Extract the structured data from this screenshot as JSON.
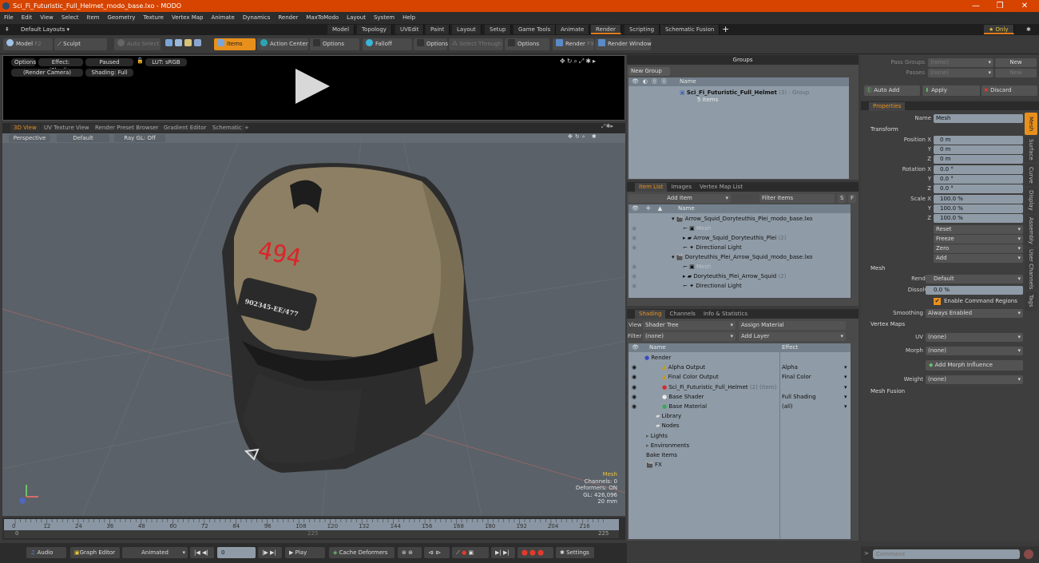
{
  "window": {
    "title": "Sci_Fi_Futuristic_Full_Helmet_modo_base.lxo - MODO",
    "minimize": "—",
    "restore": "❐",
    "close": "✕"
  },
  "menu": [
    "File",
    "Edit",
    "View",
    "Select",
    "Item",
    "Geometry",
    "Texture",
    "Vertex Map",
    "Animate",
    "Dynamics",
    "Render",
    "MaxToModo",
    "Layout",
    "System",
    "Help"
  ],
  "layouts": {
    "label": "Default Layouts ▾",
    "tabs": [
      "Model",
      "Topology",
      "UVEdit",
      "Paint",
      "Layout",
      "Setup",
      "Game Tools",
      "Animate",
      "Render",
      "Scripting",
      "Schematic Fusion"
    ],
    "active": "Render",
    "add": "+",
    "only": "★ Only"
  },
  "toolbar": {
    "model": "Model",
    "model_key": "F2",
    "sculpt": "Sculpt",
    "auto_select": "Auto Select",
    "items": "Items",
    "action_center": "Action Center",
    "options1": "Options",
    "falloff": "Falloff",
    "options2": "Options",
    "select_through": "Select Through",
    "options3": "Options",
    "render": "Render",
    "render_key": "F9",
    "render_window": "Render Window"
  },
  "render_preview": {
    "options": "Options",
    "effect": "Effect: (Shadi...",
    "paused": "Paused",
    "lut": "LUT: sRGB",
    "camera": "(Render Camera)",
    "shading": "Shading: Full"
  },
  "view_tabs": {
    "tabs": [
      "3D View",
      "UV Texture View",
      "Render Preset Browser",
      "Gradient Editor",
      "Schematic"
    ],
    "active": "3D View",
    "add": "+"
  },
  "viewport": {
    "projection": "Perspective",
    "style": "Default",
    "raygl": "Ray GL: Off",
    "decal_number": "494",
    "decal_serial": "902345-EE/477",
    "stats": {
      "title": "Mesh",
      "channels": "Channels: 0",
      "deformers": "Deformers: ON",
      "gl": "GL: 426,096",
      "scale": "20 mm"
    }
  },
  "timeline": {
    "ticks": [
      "0",
      "12",
      "24",
      "36",
      "48",
      "60",
      "72",
      "84",
      "96",
      "108",
      "120",
      "132",
      "144",
      "156",
      "168",
      "180",
      "192",
      "204",
      "216"
    ],
    "start": "0",
    "end": "225",
    "current_marker": "225"
  },
  "transport": {
    "audio": "Audio",
    "graph_editor": "Graph Editor",
    "animated": "Animated",
    "frame": "0",
    "play": "Play",
    "cache_deformers": "Cache Deformers",
    "settings": "Settings"
  },
  "groups": {
    "title": "Groups",
    "new_group": "New Group",
    "col_name": "Name",
    "item_name": "Sci_Fi_Futuristic_Full_Helmet",
    "item_suffix": "(3) : Group",
    "item_sub": "5 Items"
  },
  "itemlist": {
    "tabs": [
      "Item List",
      "Images",
      "Vertex Map List"
    ],
    "active": "Item List",
    "add_item": "Add Item",
    "filter": "Filter Items",
    "s": "S",
    "f": "F",
    "col_name": "Name",
    "rows": [
      {
        "name": "Arrow_Squid_Doryteuthis_Plei_modo_base.lxo",
        "indent": 0,
        "type": "scene"
      },
      {
        "name": "Mesh",
        "indent": 1,
        "type": "mesh",
        "dim": true
      },
      {
        "name": "Arrow_Squid_Doryteuthis_Plei",
        "suffix": "(2)",
        "indent": 1,
        "type": "group"
      },
      {
        "name": "Directional Light",
        "indent": 1,
        "type": "light"
      },
      {
        "name": "Doryteuthis_Plei_Arrow_Squid_modo_base.lxo",
        "indent": 0,
        "type": "scene"
      },
      {
        "name": "Mesh",
        "indent": 1,
        "type": "mesh",
        "dim": true
      },
      {
        "name": "Doryteuthis_Plei_Arrow_Squid",
        "suffix": "(2)",
        "indent": 1,
        "type": "group"
      },
      {
        "name": "Directional Light",
        "indent": 1,
        "type": "light"
      }
    ]
  },
  "shading": {
    "tabs": [
      "Shading",
      "Channels",
      "Info & Statistics"
    ],
    "active": "Shading",
    "view_label": "View",
    "view_value": "Shader Tree",
    "assign_material": "Assign Material",
    "filter_label": "Filter",
    "filter_value": "(none)",
    "add_layer": "Add Layer",
    "col_name": "Name",
    "col_effect": "Effect",
    "rows": [
      {
        "name": "Render",
        "effect": "",
        "indent": 0
      },
      {
        "name": "Alpha Output",
        "effect": "Alpha",
        "indent": 1
      },
      {
        "name": "Final Color Output",
        "effect": "Final Color",
        "indent": 1
      },
      {
        "name": "Sci_Fi_Futuristic_Full_Helmet",
        "suffix": "(2) (Item)",
        "effect": "",
        "indent": 1
      },
      {
        "name": "Base Shader",
        "effect": "Full Shading",
        "indent": 1
      },
      {
        "name": "Base Material",
        "effect": "(all)",
        "indent": 1
      },
      {
        "name": "Library",
        "effect": "",
        "indent": 0
      },
      {
        "name": "Nodes",
        "effect": "",
        "indent": 0
      },
      {
        "name": "Lights",
        "effect": "",
        "indent": 0
      },
      {
        "name": "Environments",
        "effect": "",
        "indent": 0
      },
      {
        "name": "Bake Items",
        "effect": "",
        "indent": 0
      },
      {
        "name": "FX",
        "effect": "",
        "indent": 0
      }
    ]
  },
  "passes": {
    "pass_groups_label": "Pass Groups",
    "pass_groups_value": "(none)",
    "passes_label": "Passes",
    "passes_value": "(none)",
    "new": "New",
    "auto_add": "Auto Add",
    "apply": "Apply",
    "discard": "Discard"
  },
  "properties": {
    "tab": "Properties",
    "name_label": "Name",
    "name_value": "Mesh",
    "transform": "Transform",
    "position": {
      "label": "Position X",
      "x": "0 m",
      "y": "0 m",
      "z": "0 m"
    },
    "rotation": {
      "label": "Rotation X",
      "x": "0.0 °",
      "y": "0.0 °",
      "z": "0.0 °"
    },
    "scale": {
      "label": "Scale X",
      "x": "100.0 %",
      "y": "100.0 %",
      "z": "100.0 %"
    },
    "axis_y": "Y",
    "axis_z": "Z",
    "actions": [
      "Reset",
      "Freeze",
      "Zero",
      "Add"
    ],
    "mesh": "Mesh",
    "render_label": "Render",
    "render_value": "Default",
    "dissolve_label": "Dissolve",
    "dissolve_value": "0.0 %",
    "enable_cmd_regions": "Enable Command Regions",
    "smoothing_label": "Smoothing",
    "smoothing_value": "Always Enabled",
    "vertex_maps": "Vertex Maps",
    "uv_label": "UV",
    "uv_value": "(none)",
    "morph_label": "Morph",
    "morph_value": "(none)",
    "add_morph": "Add Morph Influence",
    "weight_label": "Weight",
    "weight_value": "(none)",
    "mesh_fusion": "Mesh Fusion",
    "side_tabs": [
      "Mesh",
      "Surface",
      "Curve",
      "Display",
      "Assembly",
      "User Channels",
      "Tags"
    ]
  },
  "command": {
    "placeholder": "Command"
  }
}
